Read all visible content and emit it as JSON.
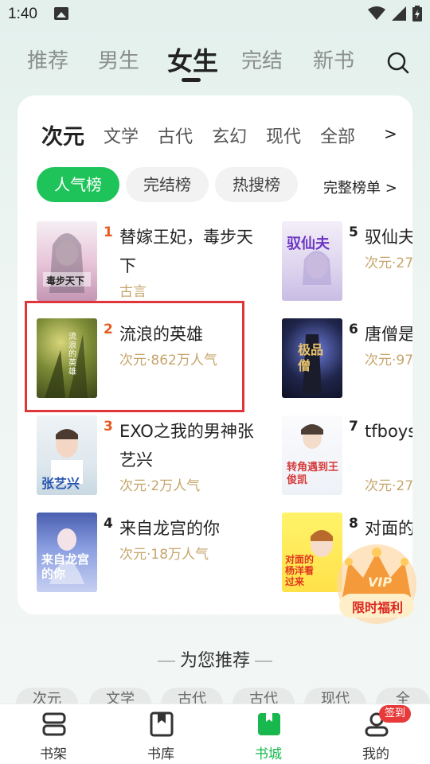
{
  "status_bar": {
    "time": "1:40"
  },
  "top_tabs": [
    "推荐",
    "男生",
    "女生",
    "完结",
    "新书"
  ],
  "categories": [
    "次元",
    "文学",
    "古代",
    "玄幻",
    "现代",
    "全部"
  ],
  "category_more": ">",
  "rank_tabs": [
    "人气榜",
    "完结榜",
    "热搜榜"
  ],
  "full_list_label": "完整榜单 >",
  "books_left": [
    {
      "rank": "1",
      "title": "替嫁王妃，毒步天下",
      "meta": "古言",
      "cover_text": "毒步天下"
    },
    {
      "rank": "2",
      "title": "流浪的英雄",
      "meta": "次元·862万人气",
      "cover_text": "流浪的英雄"
    },
    {
      "rank": "3",
      "title": "EXO之我的男神张艺兴",
      "meta": "次元·2万人气",
      "cover_text": "张艺兴"
    },
    {
      "rank": "4",
      "title": "来自龙宫的你",
      "meta": "次元·18万人气",
      "cover_text": "来自龙宫的你"
    }
  ],
  "books_right": [
    {
      "rank": "5",
      "title": "驭仙夫",
      "meta": "次元·27",
      "cover_text": "驭仙夫"
    },
    {
      "rank": "6",
      "title": "唐僧是",
      "meta": "次元·97",
      "cover_text": "极品僧"
    },
    {
      "rank": "7",
      "title": "tfboys王俊凯",
      "meta": "次元·27",
      "cover_text": "转角遇到王俊凯"
    },
    {
      "rank": "8",
      "title": "对面的",
      "meta": "",
      "cover_text": "对面的杨洋看过来"
    }
  ],
  "promo": {
    "label": "限时福利",
    "crown_text": "VIP"
  },
  "recommend_heading": "为您推荐",
  "chips": [
    "次元",
    "文学",
    "古代",
    "古代",
    "现代",
    "全"
  ],
  "bottom_nav": [
    "书架",
    "书库",
    "书城",
    "我的"
  ],
  "checkin_badge": "签到"
}
